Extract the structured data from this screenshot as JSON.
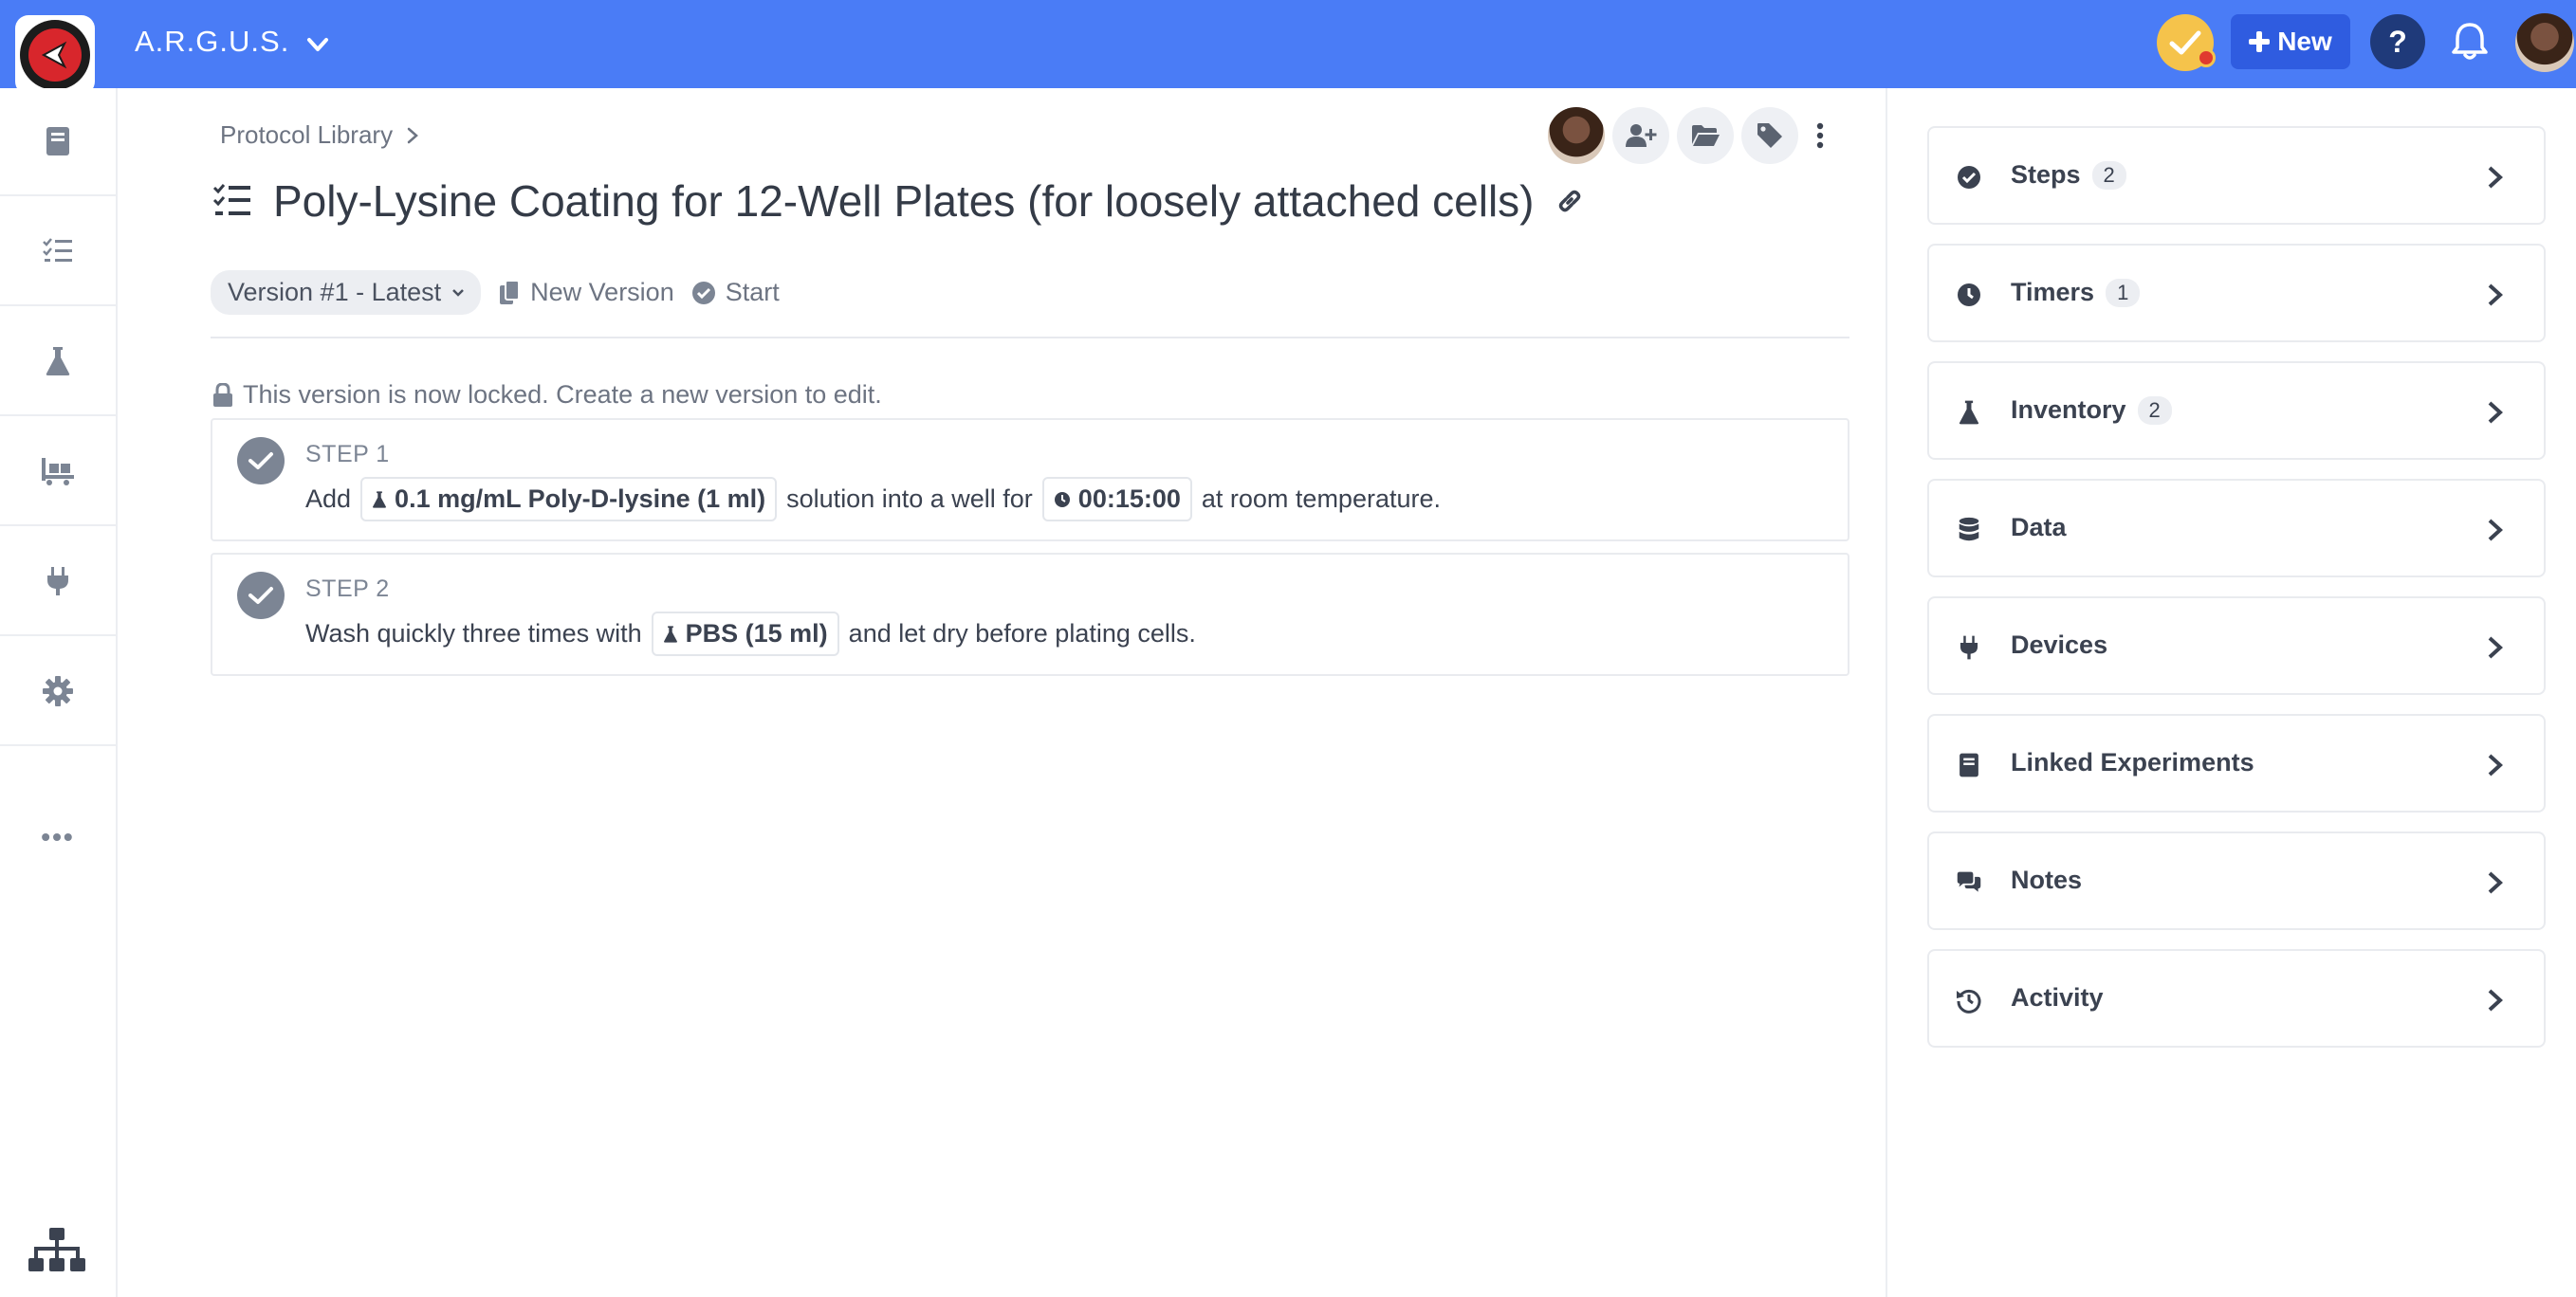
{
  "app": {
    "name": "A.R.G.U.S.",
    "new_label": "New",
    "help_label": "?"
  },
  "breadcrumb": {
    "label": "Protocol Library"
  },
  "protocol": {
    "title": "Poly-Lysine Coating for 12-Well Plates (for loosely attached cells)",
    "version_label": "Version #1 - Latest",
    "new_version_label": "New Version",
    "start_label": "Start",
    "locked_message": "This version is now locked. Create a new version to edit."
  },
  "steps": [
    {
      "label": "STEP 1",
      "text_before": "Add",
      "chip1": "0.1 mg/mL Poly-D-lysine (1 ml)",
      "text_middle": "solution into a well for",
      "chip2": "00:15:00",
      "text_after": "at room temperature."
    },
    {
      "label": "STEP 2",
      "text_before": "Wash quickly three times with",
      "chip1": "PBS (15 ml)",
      "text_after": "and let dry before plating cells."
    }
  ],
  "right_panel": {
    "items": [
      {
        "label": "Steps",
        "badge": "2",
        "icon": "check-circle-icon"
      },
      {
        "label": "Timers",
        "badge": "1",
        "icon": "clock-icon"
      },
      {
        "label": "Inventory",
        "badge": "2",
        "icon": "flask-icon"
      },
      {
        "label": "Data",
        "badge": "",
        "icon": "database-icon"
      },
      {
        "label": "Devices",
        "badge": "",
        "icon": "plug-icon"
      },
      {
        "label": "Linked Experiments",
        "badge": "",
        "icon": "book-icon"
      },
      {
        "label": "Notes",
        "badge": "",
        "icon": "comments-icon"
      },
      {
        "label": "Activity",
        "badge": "",
        "icon": "history-icon"
      }
    ]
  },
  "colors": {
    "topbar": "#4a7cf6",
    "new_button": "#2f5ce0",
    "icon_grey": "#7c8594"
  }
}
